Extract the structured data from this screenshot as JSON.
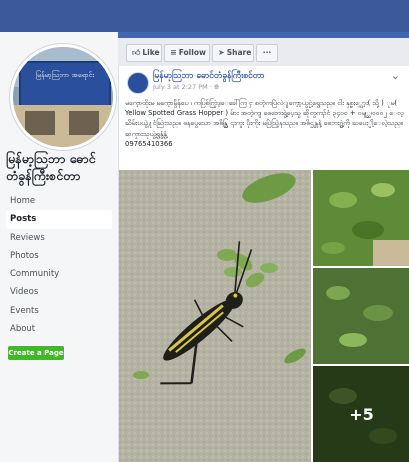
{
  "page": {
    "name": "မြန်မာ့သြဘာ ဓောင်တံခွန်ကြီးစင်တာ",
    "profile_sign_text": "မြန်မာ့သြဘာ အရောင်း"
  },
  "nav": {
    "items": [
      "Home",
      "Posts",
      "Reviews",
      "Photos",
      "Community",
      "Videos",
      "Events",
      "About"
    ],
    "active": "Posts",
    "create_page": "Create a Page"
  },
  "actions": {
    "like": "Like",
    "follow": "Follow",
    "share": "Share",
    "more": "···"
  },
  "post": {
    "author": "မြန်မာ့သြဘာ ဓောင်တံခွန်ကြီးစင်တာ",
    "time": "July 3 at 2:27 PM · ",
    "body": "မကေ့ာထိုးမ မကေ့ာမွိန်ပေ ၊ ကပြစ်ကြွဲဒ့ေခေါ်ကြ ႁ စတဲ့ကပြဲလဲျကေ့ာ့ယွင္ပဲ့ရွေသည္။ ငါး နှစ္မႏ္ကေ့ား( သို့ ) ႂမ( Yellow Spotted Grass Hopper ) မ်ား အတဲ့ကျ ဓေဘေးရွဲ့ပေ့သွ ဆိုတွကၣ်ငံ ၃၄၀၀ + ၀မျ္ဆ၊၀၀၀၂ ေလ့ ႀိမ်းပယွဲ႔ငံႀြဲးသည္။ ဓနပွေသော အဓိန္တြ ၎းကူး ပိုးကိုး မပြဲသြဲ့နသည္။ အဓိဌန္တနဲ့ ဓေဘး႐ွဲ့ကို ႀပေႏ္ပါဲ့ေလဲ့သည္။",
    "contact": "ဆကၠားသုယွဲ့ရွနွံ့နွံ့",
    "phone": "09765410366",
    "more_photos": "+5"
  },
  "colors": {
    "brand_blue": "#3b5998",
    "link_blue": "#385898",
    "create_green": "#42b72a"
  },
  "icons": {
    "like": "thumbs-up-icon",
    "follow": "rss-icon",
    "share": "share-arrow-icon",
    "globe": "globe-icon"
  }
}
